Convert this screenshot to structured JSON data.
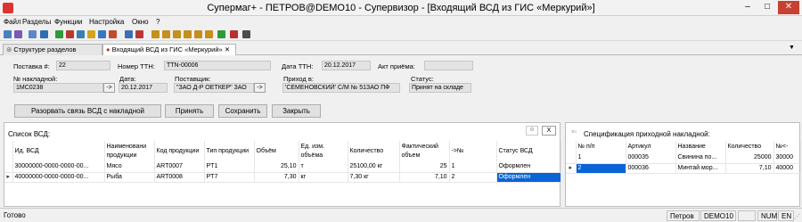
{
  "window": {
    "title": "Супермаг+ - ПЕТРОВ@DEMO10 - Супервизор - [Входящий ВСД из ГИС «Меркурий»]"
  },
  "menu": [
    "Файл",
    "Разделы",
    "Функции",
    "Настройка",
    "Окно",
    "?"
  ],
  "tabs": [
    {
      "label": "Структуре разделов"
    },
    {
      "label": "Входящий ВСД из ГИС «Меркурий»"
    }
  ],
  "form": {
    "postavka_label": "Поставка #:",
    "postavka_value": "22",
    "ttn_num_label": "Номер ТТН:",
    "ttn_num_value": "TTN-00006",
    "ttn_date_label": "Дата ТТН:",
    "ttn_date_value": "20.12.2017",
    "act_label": "Акт приёма:",
    "act_value": "",
    "nakl_label": "№ накладной:",
    "nakl_value": "1МС0238",
    "date_label": "Дата:",
    "date_value": "20.12.2017",
    "supplier_label": "Поставщик:",
    "supplier_value": "\"ЗАО Д-Р ОЕТКЕР\" ЗАО",
    "prihod_label": "Приход в:",
    "prihod_value": "'СЕМЕНОВСКИЙ' С/М № 51ЗАО ПФ",
    "status_label": "Статус:",
    "status_value": "Принят на складе",
    "arrow": "->"
  },
  "buttons": {
    "unlink": "Разорвать связь ВСД с накладной",
    "accept": "Принять",
    "save": "Сохранить",
    "close": "Закрыть"
  },
  "vsd_list": {
    "title": "Список ВСД:",
    "close_btn": "X",
    "columns": [
      "Ид. ВСД",
      "Наименовани продукции",
      "Код продукции",
      "Тип продукции",
      "Объём",
      "Ед. изм. объёма",
      "Количество",
      "Фактический объем",
      "->№",
      "Статус ВСД"
    ],
    "rows": [
      [
        "30000000-0000-0000-00...",
        "Мясо",
        "ART0007",
        "PT1",
        "25,10",
        "т",
        "25100,00 кг",
        "25",
        "1",
        "Оформлен"
      ],
      [
        "40000000-0000-0000-00...",
        "Рыба",
        "ART0008",
        "PT7",
        "7,30",
        "кг",
        "7,30 кг",
        "7,10",
        "2",
        "Оформлен"
      ]
    ]
  },
  "spec": {
    "title": "Спецификация приходной накладной:",
    "columns": [
      "№ п/п",
      "Артикул",
      "Название",
      "Количество",
      "№<-"
    ],
    "rows": [
      [
        "1",
        "000035",
        "Свинина по...",
        "25000",
        "30000"
      ],
      [
        "2",
        "000036",
        "Минтай мор...",
        "7,10",
        "40000"
      ]
    ]
  },
  "status": {
    "left": "Готово",
    "user": "Петров",
    "db": "DEMO10",
    "num": "NUM",
    "lang": "EN"
  }
}
